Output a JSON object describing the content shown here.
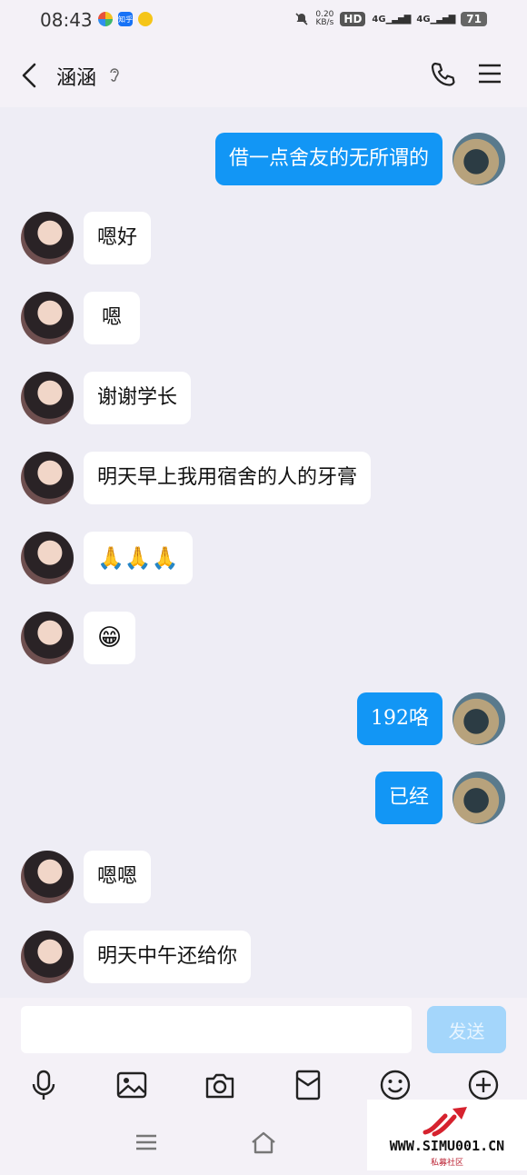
{
  "status": {
    "time": "08:43",
    "app_icons": [
      "qq-icon",
      "zhihu-icon",
      "qq-music-icon"
    ],
    "zhihu_label": "知乎",
    "speed_value": "0.20",
    "speed_unit": "KB/s",
    "hd_label": "HD",
    "sig1": "4G",
    "sig2": "4G",
    "battery": "71"
  },
  "header": {
    "contact_name": "涵涵"
  },
  "messages": [
    {
      "side": "out",
      "text": "借一点舍友的无所谓的"
    },
    {
      "side": "in",
      "text": "嗯好"
    },
    {
      "side": "in",
      "text": "嗯"
    },
    {
      "side": "in",
      "text": "谢谢学长"
    },
    {
      "side": "in",
      "text": "明天早上我用宿舍的人的牙膏"
    },
    {
      "side": "in",
      "text": "🙏🙏🙏"
    },
    {
      "side": "in",
      "text": "😁"
    },
    {
      "side": "out",
      "text": "192咯"
    },
    {
      "side": "out",
      "text": "已经"
    },
    {
      "side": "in",
      "text": "嗯嗯"
    },
    {
      "side": "in",
      "text": "明天中午还给你"
    }
  ],
  "composer": {
    "input_value": "",
    "send_label": "发送"
  },
  "toolbar": [
    "microphone-icon",
    "image-icon",
    "camera-icon",
    "red-packet-icon",
    "emoji-icon",
    "plus-icon"
  ],
  "watermark": {
    "url": "WWW.SIMU001.CN",
    "sub": "私募社区"
  },
  "colors": {
    "out_bubble": "#1296f5",
    "in_bubble": "#ffffff",
    "chat_bg": "#eeedf5",
    "send_disabled": "#a4d6fb"
  }
}
